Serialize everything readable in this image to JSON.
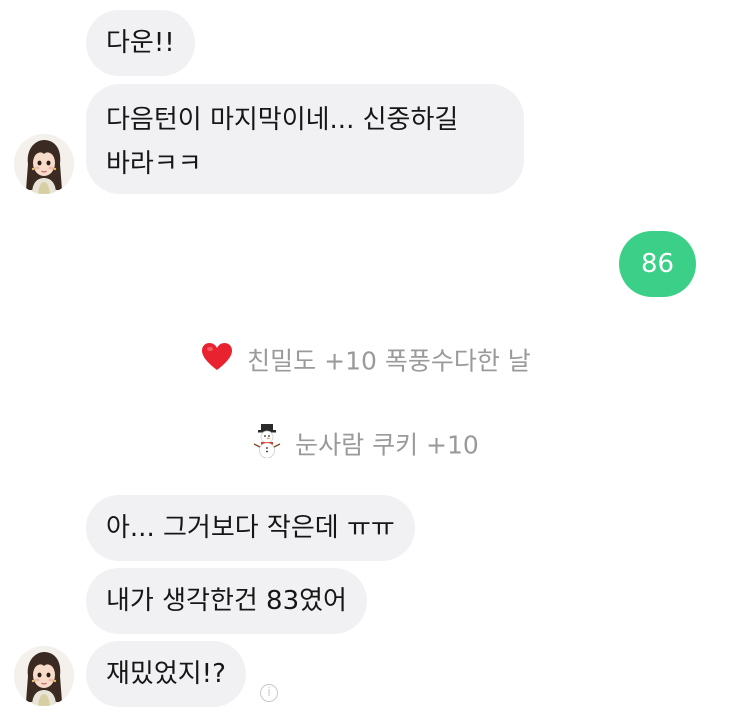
{
  "messages_top": [
    {
      "text": "다운!!"
    },
    {
      "line1": "다음턴이 마지막이네... 신중하길",
      "line2": "바라ㅋㅋ"
    }
  ],
  "sent": {
    "text": "86"
  },
  "system_events": [
    {
      "icon": "heart-icon",
      "label": "친밀도 +10 폭풍수다한 날"
    },
    {
      "icon": "snowman-icon",
      "label": "눈사람 쿠키 +10"
    }
  ],
  "messages_bottom": [
    {
      "text": "아... 그거보다 작은데 ㅠㅠ"
    },
    {
      "text": "내가 생각한건 83였어"
    },
    {
      "text": "재밌었지!?"
    }
  ],
  "colors": {
    "received_bubble": "#f1f1f3",
    "sent_bubble": "#3ccf88",
    "system_text": "#9a9a9c",
    "heart": "#e8232f"
  }
}
